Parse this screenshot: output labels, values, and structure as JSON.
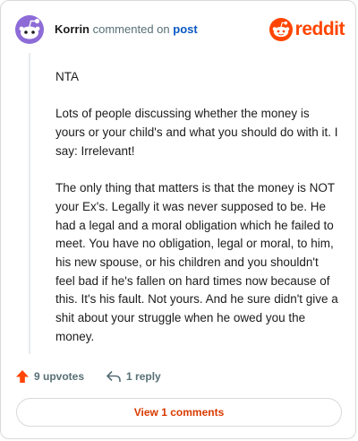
{
  "header": {
    "author": "Korrin",
    "commented_text": "commented on",
    "post_link": "post",
    "brand_word": "reddit"
  },
  "comment": {
    "paragraphs": [
      "NTA",
      "Lots of people discussing whether the money is yours or your child's and what you should do with it. I say: Irrelevant!",
      "The only thing that matters is that the money is NOT your Ex's. Legally it was never supposed to be. He had a legal and a moral obligation which he failed to meet. You have no obligation, legal or moral, to him, his new spouse, or his children and you shouldn't feel bad if he's fallen on hard times now because of this. It's his fault. Not yours. And he sure didn't give a shit about your struggle when he owed you the money."
    ]
  },
  "actions": {
    "upvotes_label": "9 upvotes",
    "reply_label": "1 reply"
  },
  "footer": {
    "view_comments_label": "View 1 comments"
  },
  "colors": {
    "brand": "#ff4500",
    "avatar": "#8d6cd7",
    "link": "#0a57c2",
    "view_comments": "#d93a00"
  }
}
